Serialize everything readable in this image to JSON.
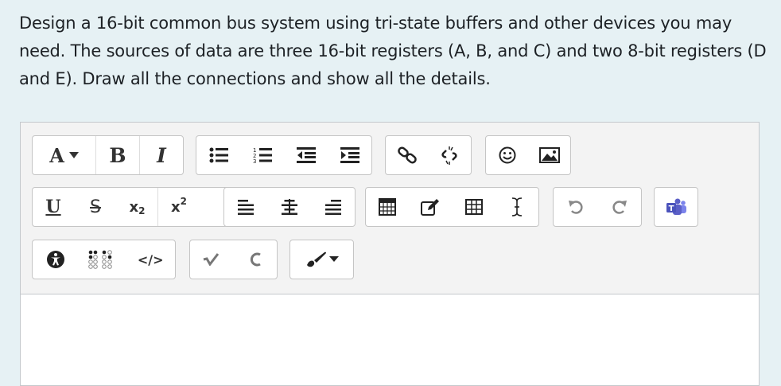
{
  "question": {
    "text": "Design a 16-bit common bus system using tri-state buffers and other devices you may need. The sources of data are three 16-bit registers (A, B, and C) and two 8-bit registers (D and E). Draw all the connections and show all the details."
  },
  "toolbar": {
    "font_style_letter": "A",
    "bold_letter": "B",
    "italic_letter": "I",
    "underline_letter": "U",
    "strike_letter": "S",
    "subscript_base": "x",
    "subscript_sub": "2",
    "superscript_base": "x",
    "superscript_sup": "2",
    "html_label": "</>"
  },
  "icons": [
    "dropdown-caret-icon",
    "bullet-list-icon",
    "numbered-list-icon",
    "outdent-icon",
    "indent-icon",
    "link-icon",
    "unlink-icon",
    "emoji-icon",
    "image-icon",
    "align-left-icon",
    "align-center-icon",
    "align-right-icon",
    "table-grid-icon",
    "edit-icon",
    "table-icon",
    "text-cursor-icon",
    "undo-icon",
    "redo-icon",
    "teams-icon",
    "accessibility-icon",
    "braille-icon",
    "equation-icon",
    "chemistry-icon",
    "paintbrush-icon"
  ]
}
